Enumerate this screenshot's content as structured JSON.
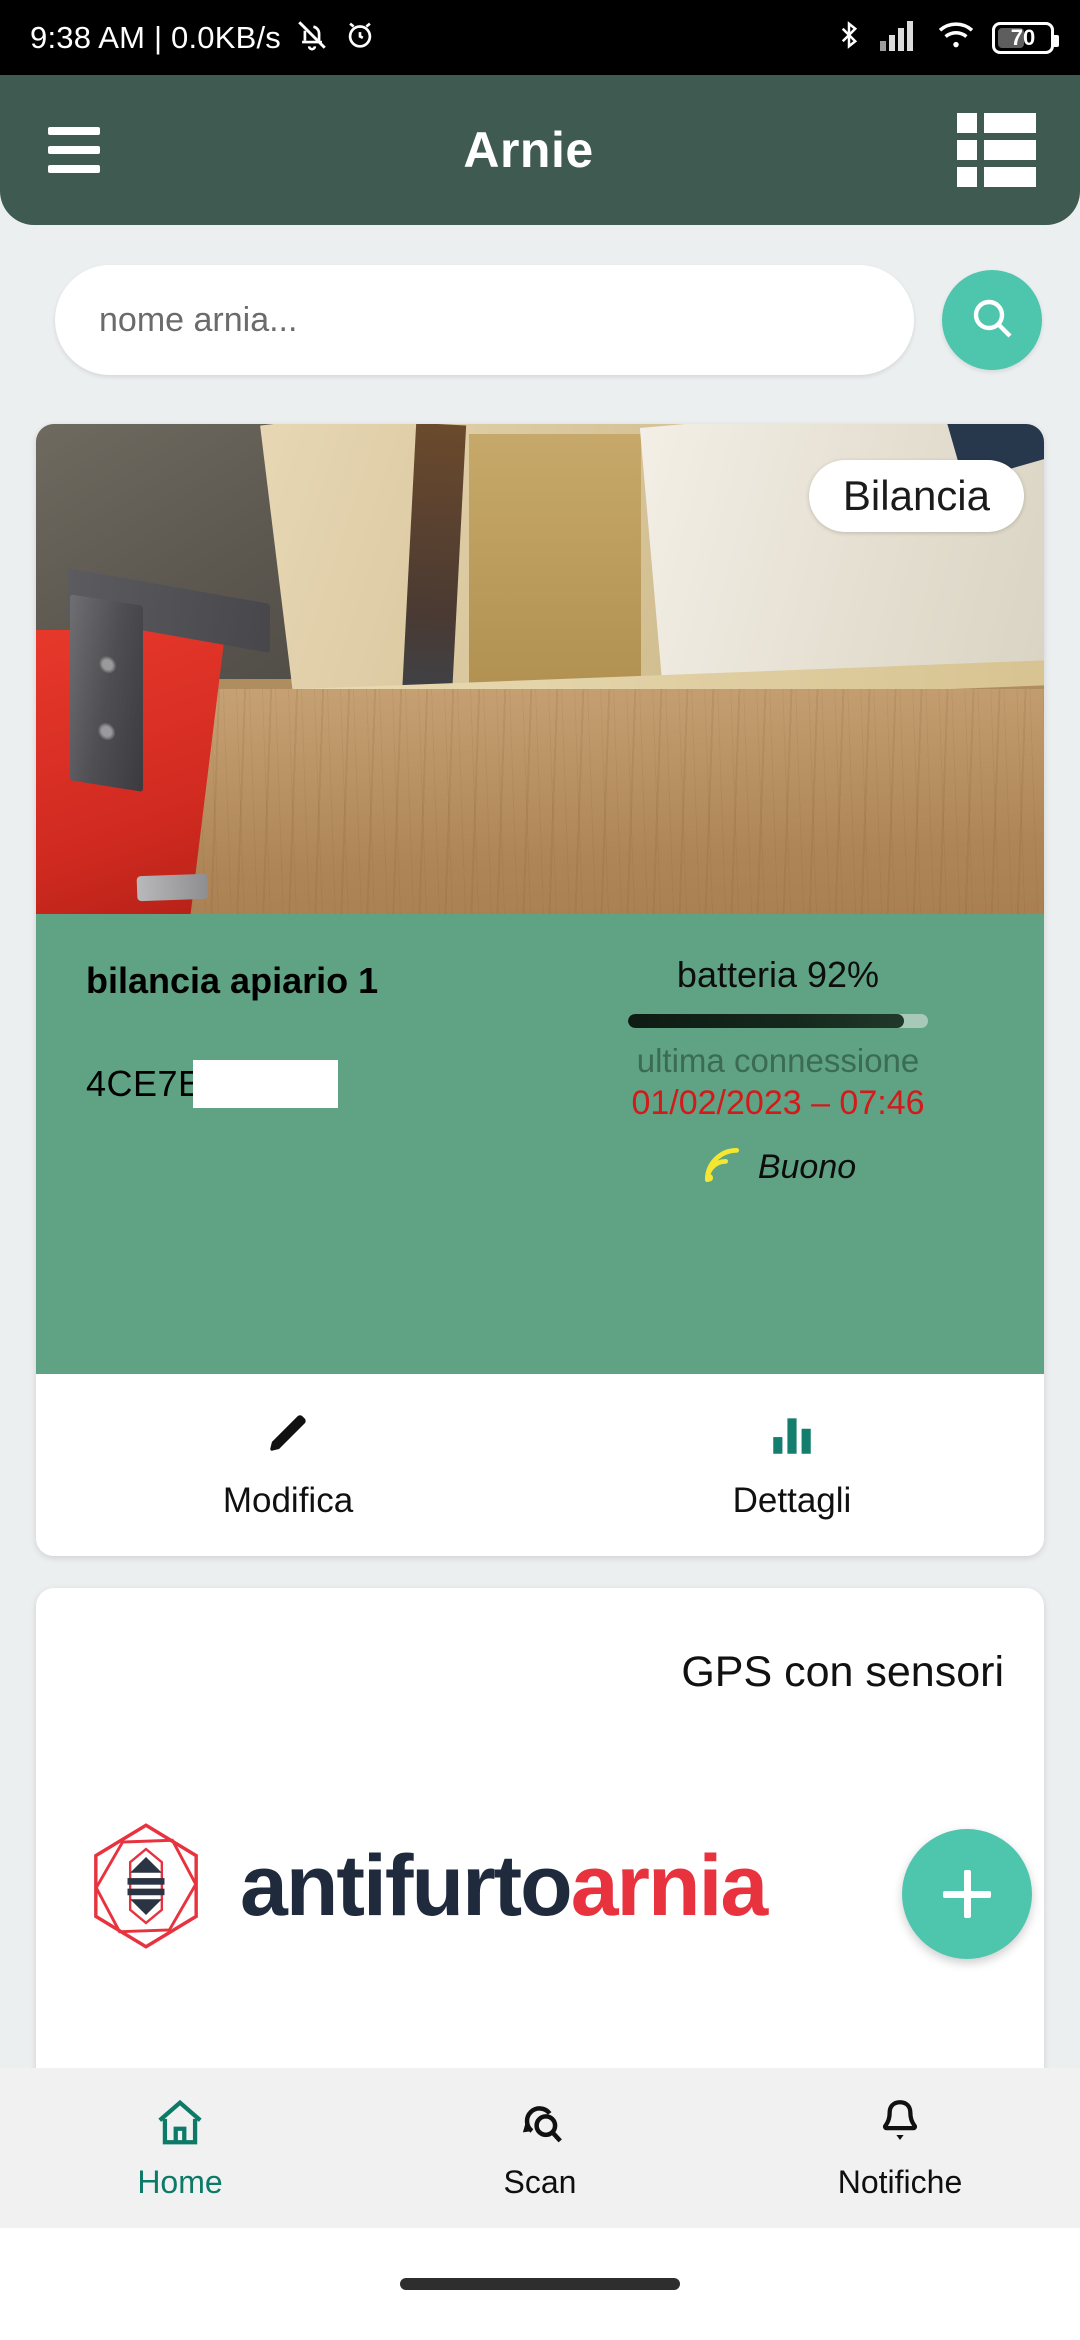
{
  "status_bar": {
    "clock": "9:38 AM | 0.0KB/s",
    "mute_icon": "bell-mute-icon",
    "alarm_icon": "alarm-clock-icon",
    "bluetooth_icon": "bluetooth-icon",
    "signal_icon": "cellular-signal-icon",
    "wifi_icon": "wifi-icon",
    "battery_level": "70"
  },
  "app_bar": {
    "menu_icon": "hamburger-menu-icon",
    "title": "Arnie",
    "view_icon": "list-view-icon"
  },
  "search": {
    "placeholder": "nome arnia...",
    "value": "",
    "button_icon": "search-icon"
  },
  "hive_card": {
    "photo_badge": "Bilancia",
    "name": "bilancia apiario 1",
    "device_id": "4CE7E",
    "device_id_redacted": true,
    "battery_label": "batteria 92%",
    "battery_percent": 92,
    "last_connection_label": "ultima connessione",
    "last_connection_value": "01/02/2023 – 07:46",
    "signal_icon": "signal-waves-icon",
    "signal_quality": "Buono",
    "actions": [
      {
        "label": "Modifica",
        "icon": "pencil-icon"
      },
      {
        "label": "Dettagli",
        "icon": "bar-chart-icon"
      }
    ]
  },
  "gps_card": {
    "title": "GPS con sensori",
    "logo_icon": "antifurtoarnia-hexagon-logo-icon",
    "logo_text_primary": "antifurto",
    "logo_text_secondary": "arnia"
  },
  "fab": {
    "icon": "plus-icon",
    "label": "+"
  },
  "bottom_nav": {
    "items": [
      {
        "label": "Home",
        "icon": "home-icon",
        "active": true
      },
      {
        "label": "Scan",
        "icon": "scan-search-icon",
        "active": false
      },
      {
        "label": "Notifiche",
        "icon": "bell-icon",
        "active": false
      }
    ]
  },
  "colors": {
    "appbar": "#3e5a51",
    "accent_teal": "#4ec5ad",
    "panel_green": "#5fa384",
    "alert_red": "#d31a1a",
    "signal_yellow": "#f5e632",
    "active_nav": "#0d7a68",
    "logo_dark": "#1f2b3d",
    "logo_red": "#e8333f"
  }
}
